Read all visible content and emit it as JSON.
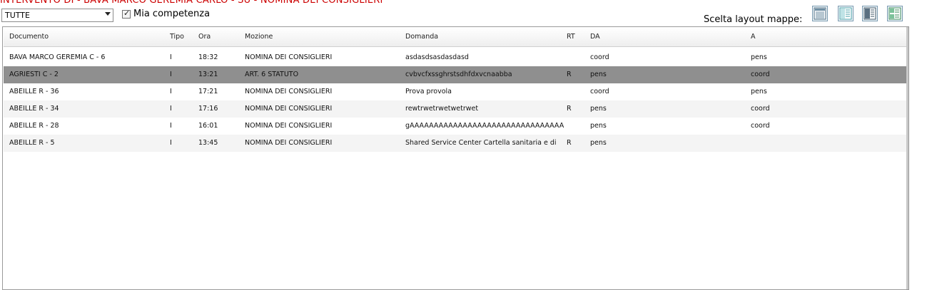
{
  "title": "INTERVENTO DI - BAVA MARCO GEREMIA CARLO - SU - NOMINA DEI CONSIGLIERI",
  "filter": {
    "selected": "TUTTE"
  },
  "competenza": {
    "label": "Mia competenza",
    "checked": true,
    "mark": "✓"
  },
  "layout": {
    "label": "Scelta layout mappe:",
    "buttons": [
      "layout-1-icon",
      "layout-2-icon",
      "layout-3-icon",
      "layout-4-icon"
    ]
  },
  "table": {
    "headers": {
      "documento": "Documento",
      "tipo": "Tipo",
      "ora": "Ora",
      "mozione": "Mozione",
      "domanda": "Domanda",
      "rt": "RT",
      "da": "DA",
      "a": "A"
    },
    "rows": [
      {
        "documento": "BAVA MARCO GEREMIA C - 6",
        "tipo": "I",
        "ora": "18:32",
        "mozione": "NOMINA DEI CONSIGLIERI",
        "domanda": "asdasdsasdasdasd",
        "rt": "",
        "da": "coord",
        "a": "pens"
      },
      {
        "documento": "AGRIESTI C - 2",
        "tipo": "I",
        "ora": "13:21",
        "mozione": "ART. 6 STATUTO",
        "domanda": "cvbvcfxssghrstsdhfdxvcnaabba",
        "rt": "R",
        "da": "pens",
        "a": "coord"
      },
      {
        "documento": "ABEILLE R - 36",
        "tipo": "I",
        "ora": "17:21",
        "mozione": "NOMINA DEI CONSIGLIERI",
        "domanda": "Prova provola",
        "rt": "",
        "da": "coord",
        "a": "pens"
      },
      {
        "documento": "ABEILLE R - 34",
        "tipo": "I",
        "ora": "17:16",
        "mozione": "NOMINA DEI CONSIGLIERI",
        "domanda": "rewtrwetrwetwetrwet",
        "rt": "R",
        "da": "pens",
        "a": "coord"
      },
      {
        "documento": "ABEILLE R - 28",
        "tipo": "I",
        "ora": "16:01",
        "mozione": "NOMINA DEI CONSIGLIERI",
        "domanda": "gAAAAAAAAAAAAAAAAAAAAAAAAAAAAAAAAAAAA",
        "rt": "",
        "da": "pens",
        "a": "coord"
      },
      {
        "documento": "ABEILLE R - 5",
        "tipo": "I",
        "ora": "13:45",
        "mozione": "NOMINA DEI CONSIGLIERI",
        "domanda": "Shared Service Center Cartella sanitaria e di",
        "rt": "R",
        "da": "pens",
        "a": ""
      }
    ],
    "selected_row": 1
  },
  "colors": {
    "title": "#cc0000",
    "selected_row": "#8f8f8f",
    "alt_row": "#f4f4f4"
  }
}
